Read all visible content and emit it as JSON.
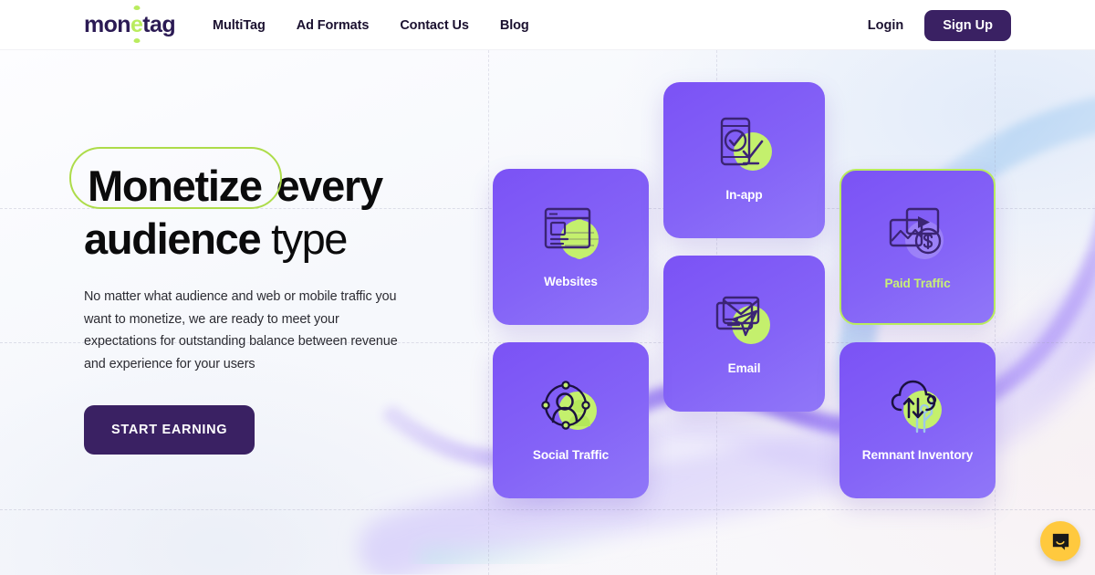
{
  "header": {
    "logo_text_a": "mon",
    "logo_text_e": "e",
    "logo_text_b": "tag",
    "nav": [
      {
        "label": "MultiTag"
      },
      {
        "label": "Ad Formats"
      },
      {
        "label": "Contact Us"
      },
      {
        "label": "Blog"
      }
    ],
    "login_label": "Login",
    "signup_label": "Sign Up"
  },
  "hero": {
    "headline_circled": "Monetize",
    "headline_bold_1": "every",
    "headline_bold_2": "audience",
    "headline_light": "type",
    "paragraph": "No matter what audience and web or mobile traffic you want to monetize, we are ready to meet your expectations for outstanding balance between revenue and experience for your users",
    "cta_label": "START EARNING"
  },
  "cards": [
    {
      "label": "Websites",
      "icon": "browser-globe-icon",
      "active": false
    },
    {
      "label": "In-app",
      "icon": "phone-check-icon",
      "active": false
    },
    {
      "label": "Paid Traffic",
      "icon": "video-dollar-icon",
      "active": true
    },
    {
      "label": "Email",
      "icon": "envelope-send-icon",
      "active": false
    },
    {
      "label": "Social Traffic",
      "icon": "social-network-icon",
      "active": false
    },
    {
      "label": "Remnant Inventory",
      "icon": "cloud-transfer-icon",
      "active": false
    }
  ],
  "widget": {
    "chat_label": "chat-bubble-icon"
  },
  "colors": {
    "brand_purple": "#7b52f5",
    "brand_dark": "#3a2163",
    "accent_lime": "#b9ec5e",
    "ink": "#1b1130",
    "card_label_active": "#c8ef77"
  }
}
